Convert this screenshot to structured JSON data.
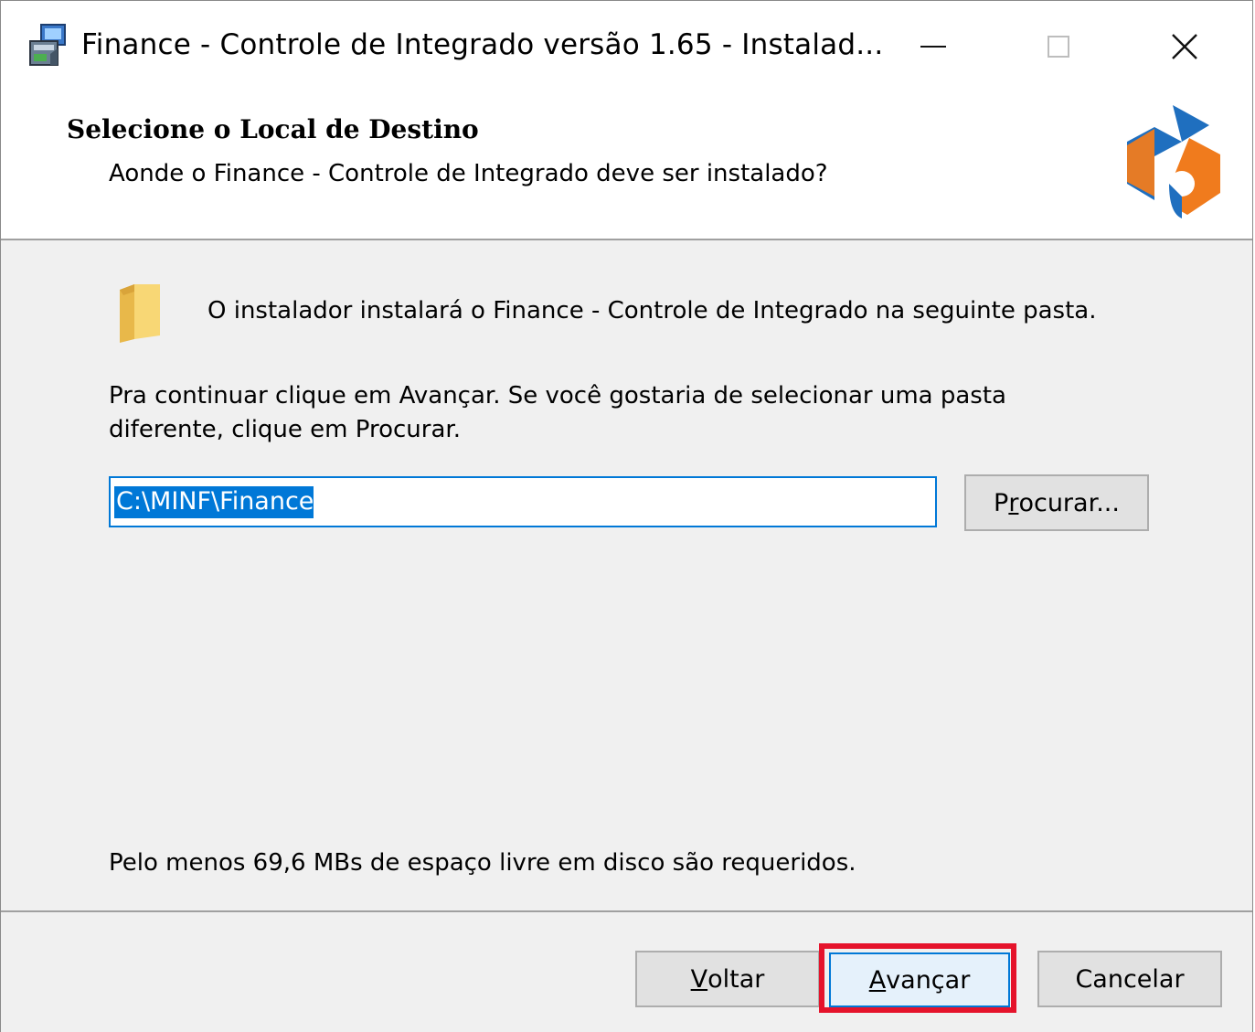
{
  "window": {
    "title": "Finance - Controle de Integrado versão 1.65 - Instalad..."
  },
  "header": {
    "title": "Selecione o Local de Destino",
    "subtitle": "Aonde o Finance - Controle de Integrado deve ser instalado?"
  },
  "body": {
    "intro": "O instalador instalará o Finance - Controle de Integrado na seguinte pasta.",
    "instruction": "Pra continuar clique em Avançar. Se você gostaria de selecionar uma pasta diferente, clique em Procurar.",
    "install_path": "C:\\MINF\\Finance",
    "browse_label_pre": "P",
    "browse_label_ul": "r",
    "browse_label_post": "ocurar...",
    "space_required": "Pelo menos 69,6 MBs de espaço livre em disco são requeridos."
  },
  "footer": {
    "back_ul": "V",
    "back_rest": "oltar",
    "next_ul": "A",
    "next_rest": "vançar",
    "cancel_label": "Cancelar"
  },
  "colors": {
    "accent": "#0078d7",
    "highlight": "#e5132b",
    "logo_blue": "#1f6fbf",
    "logo_orange": "#f07b1d"
  },
  "icons": {
    "app": "installer-icon",
    "folder": "folder-icon",
    "logo": "brand-logo",
    "minimize": "minimize-icon",
    "maximize": "maximize-icon",
    "close": "close-icon"
  }
}
